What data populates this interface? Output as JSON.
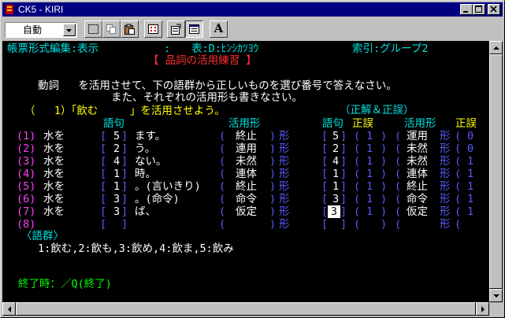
{
  "window": {
    "title": "CK5 - KIRI"
  },
  "toolbar": {
    "mode_value": "自動",
    "font_button_label": "A"
  },
  "screen": {
    "header_left": "帳票形式編集:表示",
    "header_colon": ":",
    "header_table": "表:D:ﾋﾝｼｶﾂﾖｳ",
    "header_index": "索引:グループ2",
    "title": "【 品詞の活用練習 】",
    "instruction_1": "動詞   を活用させて、下の語群から正しいものを選び番号で答えなさい。",
    "instruction_2": "また、それぞれの活用形も書きなさい。",
    "question": "（   1）「飲む     」を活用させよう。",
    "answer_heading": "（正解＆正誤）",
    "col_gokku": "語句",
    "col_katsuyoukei": "活用形",
    "col_gokku2": "語句",
    "col_seigo": "正誤",
    "col_katsuyoukei2": "活用形",
    "col_seigo2": "正誤",
    "rows": [
      {
        "num": "(1)",
        "label": "水を",
        "choice": "5",
        "suffix": "ます。",
        "form": "終止",
        "kei": "形",
        "a_choice": "5",
        "a_seigo": "1",
        "a_form": "運用",
        "a_kei": "形",
        "a_seigo2": "0"
      },
      {
        "num": "(2)",
        "label": "水を",
        "choice": "2",
        "suffix": "う。",
        "form": "連用",
        "kei": "形",
        "a_choice": "2",
        "a_seigo": "1",
        "a_form": "未然",
        "a_kei": "形",
        "a_seigo2": "0"
      },
      {
        "num": "(3)",
        "label": "水を",
        "choice": "4",
        "suffix": "ない。",
        "form": "未然",
        "kei": "形",
        "a_choice": "4",
        "a_seigo": "1",
        "a_form": "未然",
        "a_kei": "形",
        "a_seigo2": "1"
      },
      {
        "num": "(4)",
        "label": "水を",
        "choice": "1",
        "suffix": "時。",
        "form": "連体",
        "kei": "形",
        "a_choice": "1",
        "a_seigo": "1",
        "a_form": "連体",
        "a_kei": "形",
        "a_seigo2": "1"
      },
      {
        "num": "(5)",
        "label": "水を",
        "choice": "1",
        "suffix": "。(言いきり)",
        "form": "終止",
        "kei": "形",
        "a_choice": "1",
        "a_seigo": "1",
        "a_form": "終止",
        "a_kei": "形",
        "a_seigo2": "1"
      },
      {
        "num": "(6)",
        "label": "水を",
        "choice": "3",
        "suffix": "。(命令)",
        "form": "命令",
        "kei": "形",
        "a_choice": "3",
        "a_seigo": "1",
        "a_form": "命令",
        "a_kei": "形",
        "a_seigo2": "1"
      },
      {
        "num": "(7)",
        "label": "水を",
        "choice": "3",
        "suffix": "ば、",
        "form": "仮定",
        "kei": "形",
        "a_choice": "3",
        "a_seigo": "1",
        "a_form": "仮定",
        "a_kei": "形",
        "a_seigo2": "1"
      },
      {
        "num": "(8)",
        "label": "",
        "choice": "",
        "suffix": "",
        "form": "",
        "kei": "形",
        "a_choice": "",
        "a_seigo": "",
        "a_form": "",
        "a_kei": "形",
        "a_seigo2": ""
      }
    ],
    "gogun_title": "〈語群〉",
    "gogun_items": "1:飲む,2:飲も,3:飲め,4:飲ま,5:飲み",
    "footer": "終了時：／Q(終了)"
  },
  "colors": {
    "title_bar": "#000080",
    "screen_bg": "#000000",
    "cyan": "#00e0e0",
    "yellow": "#ffff00",
    "red": "#ff3030",
    "magenta": "#ff40ff",
    "green": "#00ff00",
    "blue": "#5a5aff"
  }
}
